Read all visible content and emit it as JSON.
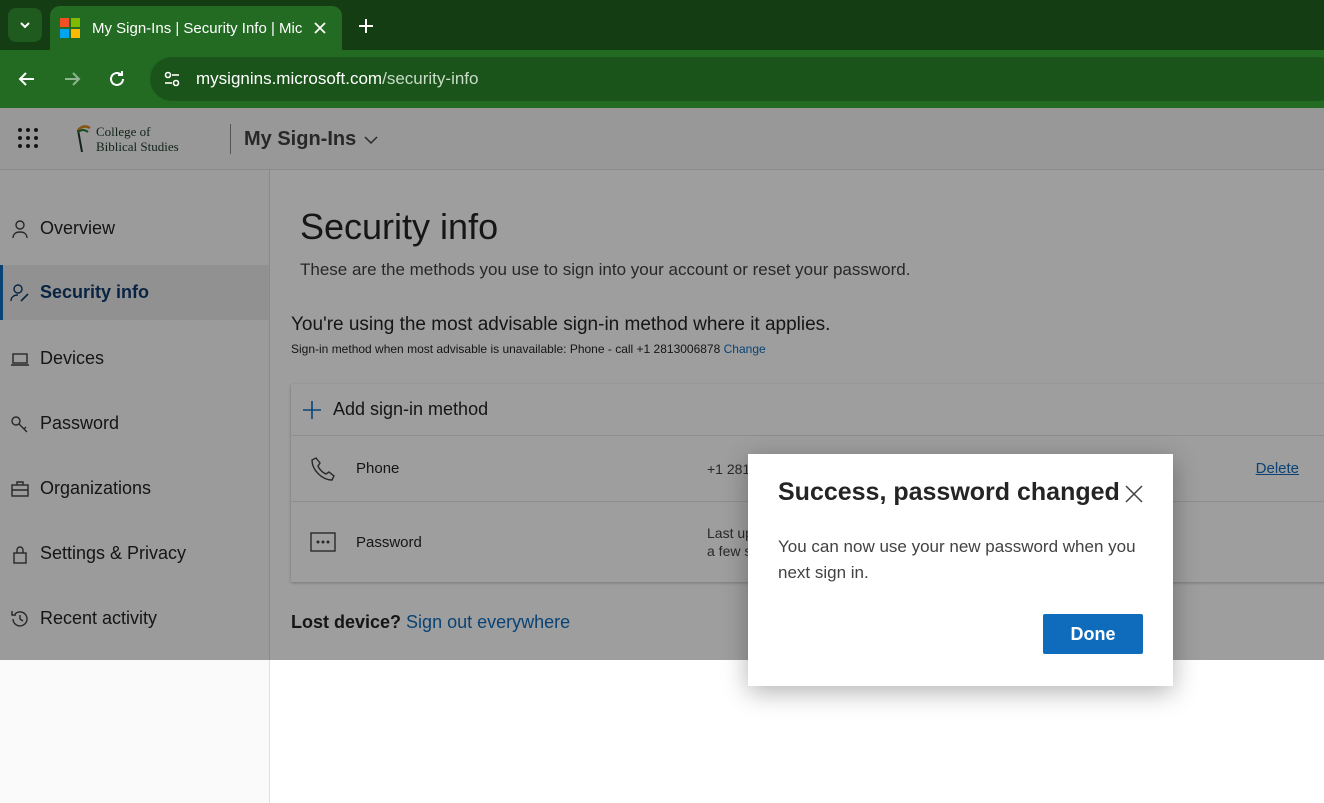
{
  "browser": {
    "tab_title": "My Sign-Ins | Security Info | Mic",
    "url_domain": "mysignins.microsoft.com",
    "url_path": "/security-info",
    "tab_icon": "microsoft-logo",
    "ms_colors": [
      "#f25022",
      "#7fba00",
      "#00a4ef",
      "#ffb900"
    ]
  },
  "header": {
    "org_line1": "College of",
    "org_line2": "Biblical Studies",
    "app_title": "My Sign-Ins"
  },
  "sidebar": {
    "items": [
      {
        "label": "Overview",
        "icon": "person-icon"
      },
      {
        "label": "Security info",
        "icon": "person-key-icon"
      },
      {
        "label": "Devices",
        "icon": "laptop-icon"
      },
      {
        "label": "Password",
        "icon": "key-icon"
      },
      {
        "label": "Organizations",
        "icon": "briefcase-icon"
      },
      {
        "label": "Settings & Privacy",
        "icon": "lock-icon"
      },
      {
        "label": "Recent activity",
        "icon": "history-icon"
      }
    ]
  },
  "main": {
    "title": "Security info",
    "description": "These are the methods you use to sign into your account or reset your password.",
    "advisable": "You're using the most advisable sign-in method where it applies.",
    "advisable_sub": "Sign-in method when most advisable is unavailable: Phone - call +1 2813006878",
    "change_link": "Change",
    "add_method": "Add sign-in method",
    "methods": [
      {
        "name": "Phone",
        "value": "+1 281",
        "action": "Delete"
      },
      {
        "name": "Password",
        "value_line1": "Last up",
        "value_line2": "a few s"
      }
    ],
    "lost_label": "Lost device?",
    "sign_out_link": "Sign out everywhere"
  },
  "dialog": {
    "title": "Success, password changed",
    "body": "You can now use your new password when you next sign in.",
    "done_label": "Done"
  },
  "colors": {
    "accent": "#0f6cbd",
    "browser_tabbar": "#143d14",
    "browser_toolbar": "#236b23"
  }
}
